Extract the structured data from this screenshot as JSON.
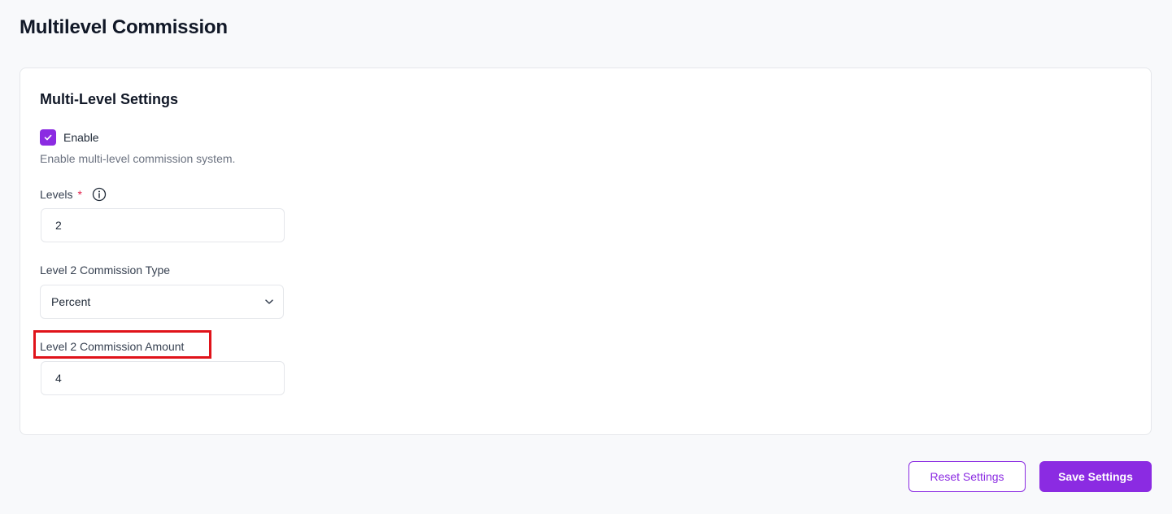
{
  "page": {
    "title": "Multilevel Commission"
  },
  "settings": {
    "title": "Multi-Level Settings",
    "enable": {
      "label": "Enable",
      "checked": true,
      "help": "Enable multi-level commission system."
    },
    "levels": {
      "label": "Levels",
      "required_mark": "*",
      "value": "2"
    },
    "commission_type": {
      "label": "Level 2 Commission Type",
      "value": "Percent"
    },
    "commission_amount": {
      "label": "Level 2 Commission Amount",
      "value": "4"
    }
  },
  "actions": {
    "reset_label": "Reset Settings",
    "save_label": "Save Settings"
  },
  "colors": {
    "accent": "#8b2be2",
    "highlight": "#e0131a",
    "required": "#e11d48"
  },
  "icons": [
    "check-icon",
    "info-icon",
    "chevron-down-icon"
  ]
}
